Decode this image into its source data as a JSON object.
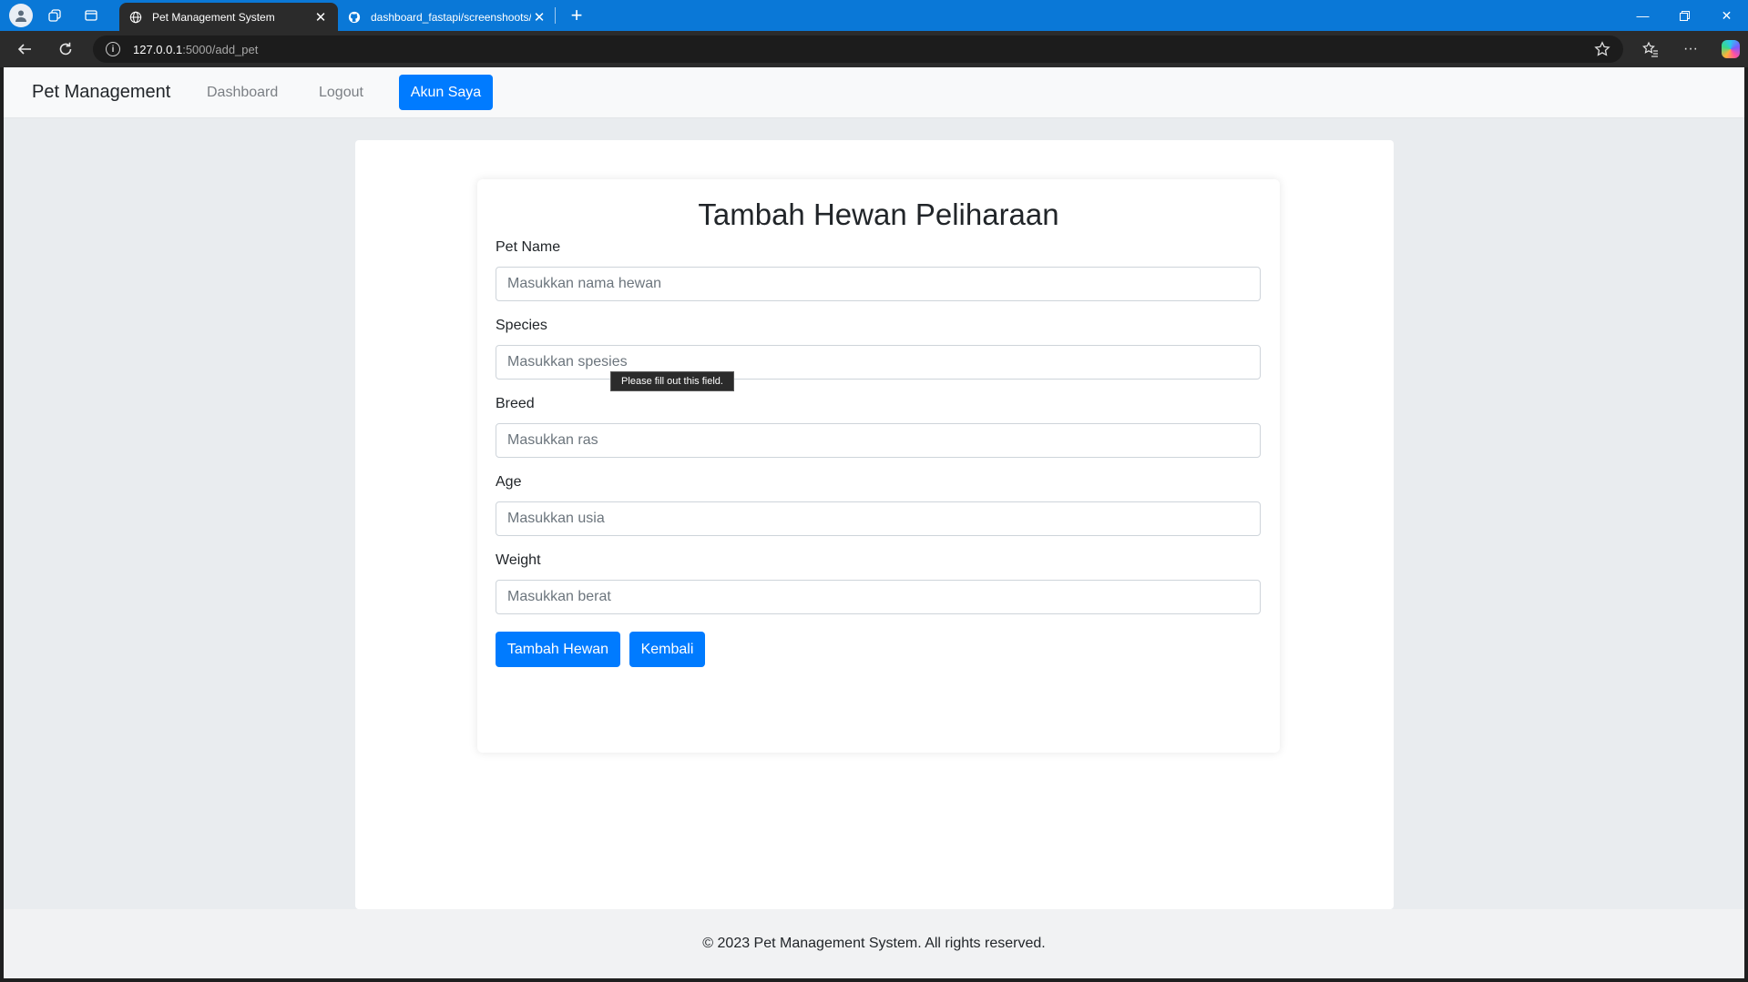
{
  "browser": {
    "tabs": [
      {
        "title": "Pet Management System",
        "active": true
      },
      {
        "title": "dashboard_fastapi/screenshoots/",
        "active": false
      }
    ],
    "url_host": "127.0.0.1",
    "url_path": ":5000/add_pet",
    "colors": {
      "tabbar": "#0a78d7",
      "toolbar": "#2b2b2b"
    }
  },
  "navbar": {
    "brand": "Pet Management",
    "links": [
      "Dashboard",
      "Logout"
    ],
    "account_button": "Akun Saya"
  },
  "form": {
    "title": "Tambah Hewan Peliharaan",
    "fields": [
      {
        "label": "Pet Name",
        "placeholder": "Masukkan nama hewan"
      },
      {
        "label": "Species",
        "placeholder": "Masukkan spesies"
      },
      {
        "label": "Breed",
        "placeholder": "Masukkan ras"
      },
      {
        "label": "Age",
        "placeholder": "Masukkan usia"
      },
      {
        "label": "Weight",
        "placeholder": "Masukkan berat"
      }
    ],
    "submit_label": "Tambah Hewan",
    "back_label": "Kembali",
    "validation_tooltip": "Please fill out this field."
  },
  "footer": {
    "text": "© 2023 Pet Management System. All rights reserved."
  },
  "theme": {
    "primary": "#007bff",
    "page_bg": "#e9ecef"
  }
}
